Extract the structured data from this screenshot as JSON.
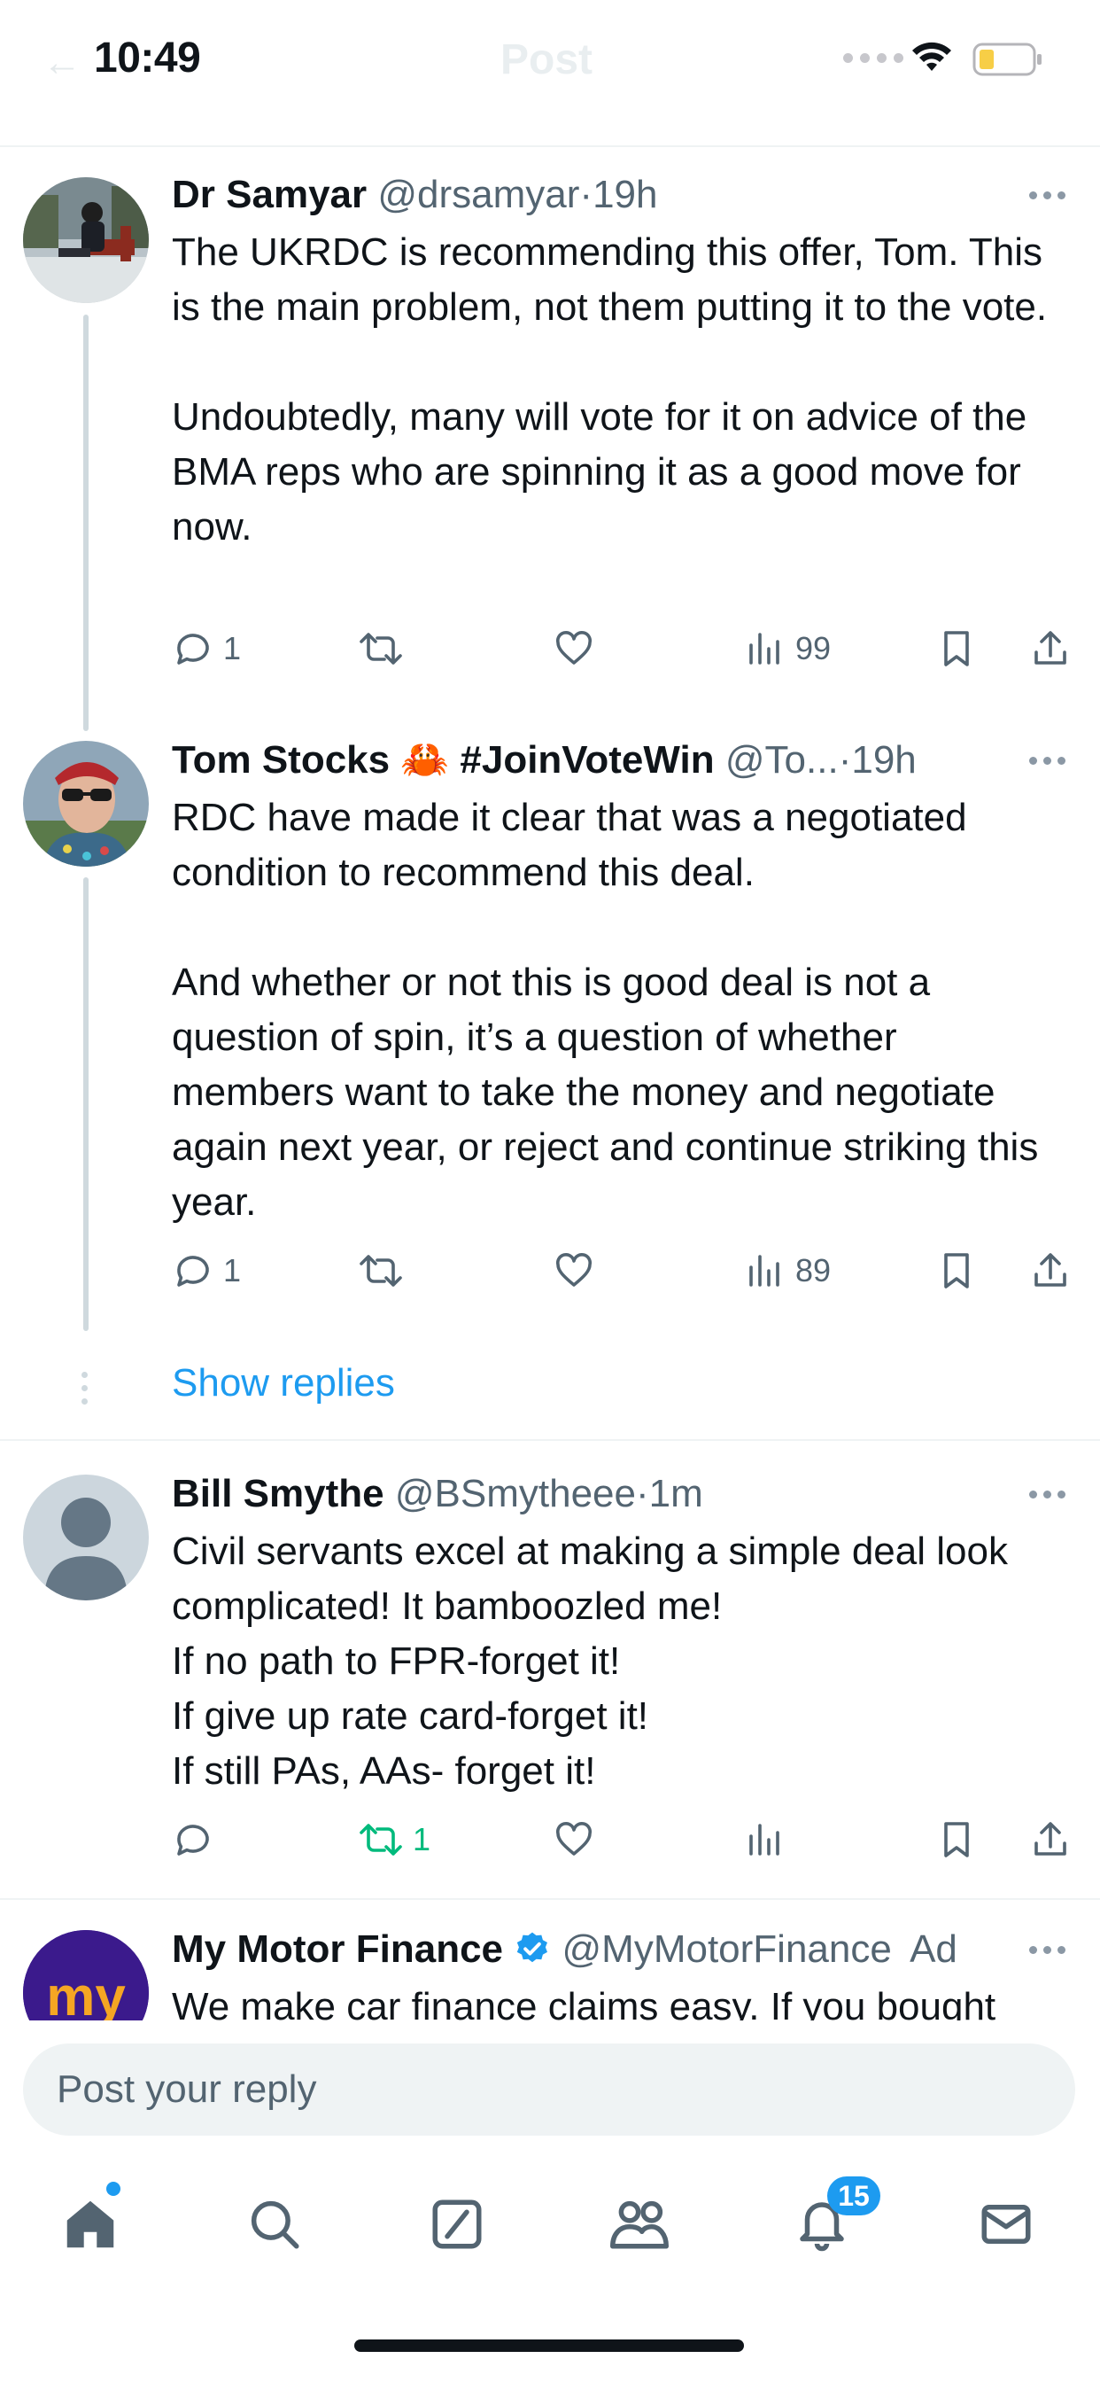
{
  "status_bar": {
    "time": "10:49"
  },
  "header": {
    "title": "Post"
  },
  "tweets": [
    {
      "name": "Dr Samyar",
      "handle": "@drsamyar",
      "dot": "·",
      "time": "19h",
      "text": "The UKRDC is recommending this offer, Tom. This is the main problem, not them putting it to the vote.\n\nUndoubtedly, many will vote for it on advice of the BMA reps who are spinning it as a good move for now.",
      "replies": "1",
      "retweets": "",
      "likes": "",
      "views": "99"
    },
    {
      "name": "Tom Stocks",
      "emoji": "🦀",
      "hashtag": "#JoinVoteWin",
      "handle": "@To...",
      "dot": "·",
      "time": "19h",
      "text": "RDC have made it clear that was a negotiated condition to recommend this deal.\n\nAnd whether or not this is good deal is not a question of spin, it’s a question of whether members want to take the money and negotiate again next year, or reject and continue striking this year.",
      "replies": "1",
      "retweets": "",
      "likes": "",
      "views": "89"
    },
    {
      "name": "Bill Smythe",
      "handle": "@BSmytheee",
      "dot": "·",
      "time": "1m",
      "text": "Civil servants excel at making a simple deal look complicated! It bamboozled me!\nIf no path to FPR-forget it!\nIf give up rate card-forget it!\nIf still PAs, AAs- forget it!",
      "replies": "",
      "retweets": "1",
      "likes": "",
      "views": ""
    },
    {
      "name": "My Motor Finance",
      "handle": "@MyMotorFinance",
      "ad_label": "Ad",
      "text": "We make car finance claims easy. If you bought",
      "avatar_text": "my"
    }
  ],
  "show_replies": "Show replies",
  "reply_bar": {
    "placeholder": "Post your reply"
  },
  "tab_bar": {
    "items": [
      "home-icon",
      "search-icon",
      "grok-icon",
      "communities-icon",
      "notifications-icon",
      "messages-icon"
    ],
    "notification_count": "15"
  },
  "colors": {
    "accent": "#1d9bf0",
    "retweet_active": "#00ba7c",
    "ad_brand": "#3b1a8c"
  }
}
